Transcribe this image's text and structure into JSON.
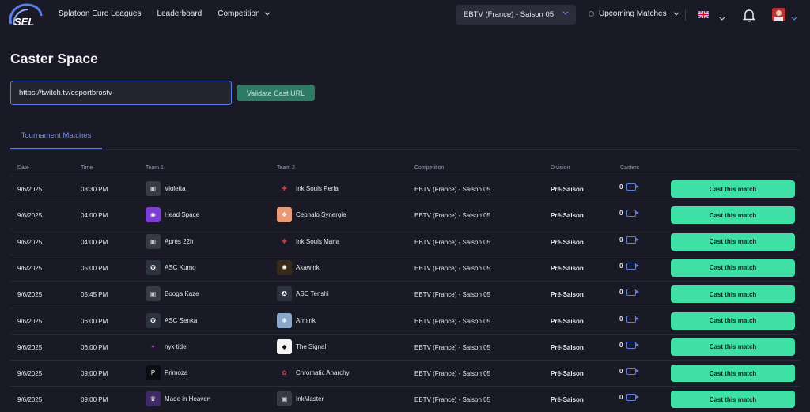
{
  "nav": {
    "logo_text": "SEL",
    "links": [
      "Splatoon Euro Leagues",
      "Leaderboard",
      "Competition"
    ],
    "season": "EBTV (France) - Saison 05",
    "upcoming": "Upcoming Matches"
  },
  "page": {
    "title": "Caster Space",
    "url_value": "https://twitch.tv/esportbrostv",
    "validate_label": "Validate Cast URL",
    "tab": "Tournament Matches"
  },
  "table": {
    "headers": [
      "Date",
      "Time",
      "Team 1",
      "Team 2",
      "Competition",
      "Division",
      "Casters"
    ],
    "rows": [
      {
        "date": "9/6/2025",
        "time": "03:30 PM",
        "team1": "Violetta",
        "team2": "Ink Souls Perla",
        "competition": "EBTV (France) - Saison 05",
        "division": "Pré-Saison",
        "casters": "0",
        "action": "Cast this match"
      },
      {
        "date": "9/6/2025",
        "time": "04:00 PM",
        "team1": "Head Space",
        "team2": "Cephalo Synergie",
        "competition": "EBTV (France) - Saison 05",
        "division": "Pré-Saison",
        "casters": "0",
        "action": "Cast this match"
      },
      {
        "date": "9/6/2025",
        "time": "04:00 PM",
        "team1": "Après 22h",
        "team2": "Ink Souls Maria",
        "competition": "EBTV (France) - Saison 05",
        "division": "Pré-Saison",
        "casters": "0",
        "action": "Cast this match"
      },
      {
        "date": "9/6/2025",
        "time": "05:00 PM",
        "team1": "ASC Kumo",
        "team2": "Akawink",
        "competition": "EBTV (France) - Saison 05",
        "division": "Pré-Saison",
        "casters": "0",
        "action": "Cast this match"
      },
      {
        "date": "9/6/2025",
        "time": "05:45 PM",
        "team1": "Booga Kaze",
        "team2": "ASC Tenshi",
        "competition": "EBTV (France) - Saison 05",
        "division": "Pré-Saison",
        "casters": "0",
        "action": "Cast this match"
      },
      {
        "date": "9/6/2025",
        "time": "06:00 PM",
        "team1": "ASC Senka",
        "team2": "Armink",
        "competition": "EBTV (France) - Saison 05",
        "division": "Pré-Saison",
        "casters": "0",
        "action": "Cast this match"
      },
      {
        "date": "9/6/2025",
        "time": "06:00 PM",
        "team1": "nyx tide",
        "team2": "The Signal",
        "competition": "EBTV (France) - Saison 05",
        "division": "Pré-Saison",
        "casters": "0",
        "action": "Cast this match"
      },
      {
        "date": "9/6/2025",
        "time": "09:00 PM",
        "team1": "Primoza",
        "team2": "Chromatic Anarchy",
        "competition": "EBTV (France) - Saison 05",
        "division": "Pré-Saison",
        "casters": "0",
        "action": "Cast this match"
      },
      {
        "date": "9/6/2025",
        "time": "09:00 PM",
        "team1": "Made in Heaven",
        "team2": "InkMaster",
        "competition": "EBTV (France) - Saison 05",
        "division": "Pré-Saison",
        "casters": "0",
        "action": "Cast this match"
      }
    ]
  },
  "icons": {
    "team1": [
      "placeholder",
      "head-space-logo",
      "placeholder",
      "asc-logo",
      "placeholder",
      "asc-logo",
      "nyx-logo",
      "primoza-logo",
      "made-in-heaven-logo"
    ],
    "team2": [
      "ink-souls-logo",
      "cephalo-logo",
      "ink-souls-logo",
      "akawink-logo",
      "asc-logo",
      "armink-logo",
      "signal-logo",
      "chromatic-logo",
      "placeholder"
    ]
  },
  "colors": {
    "background": "#1a1a26",
    "accent_blue": "#5b7fe6",
    "cast_button": "#3fe0a6",
    "validate_button": "#2f7a64"
  }
}
